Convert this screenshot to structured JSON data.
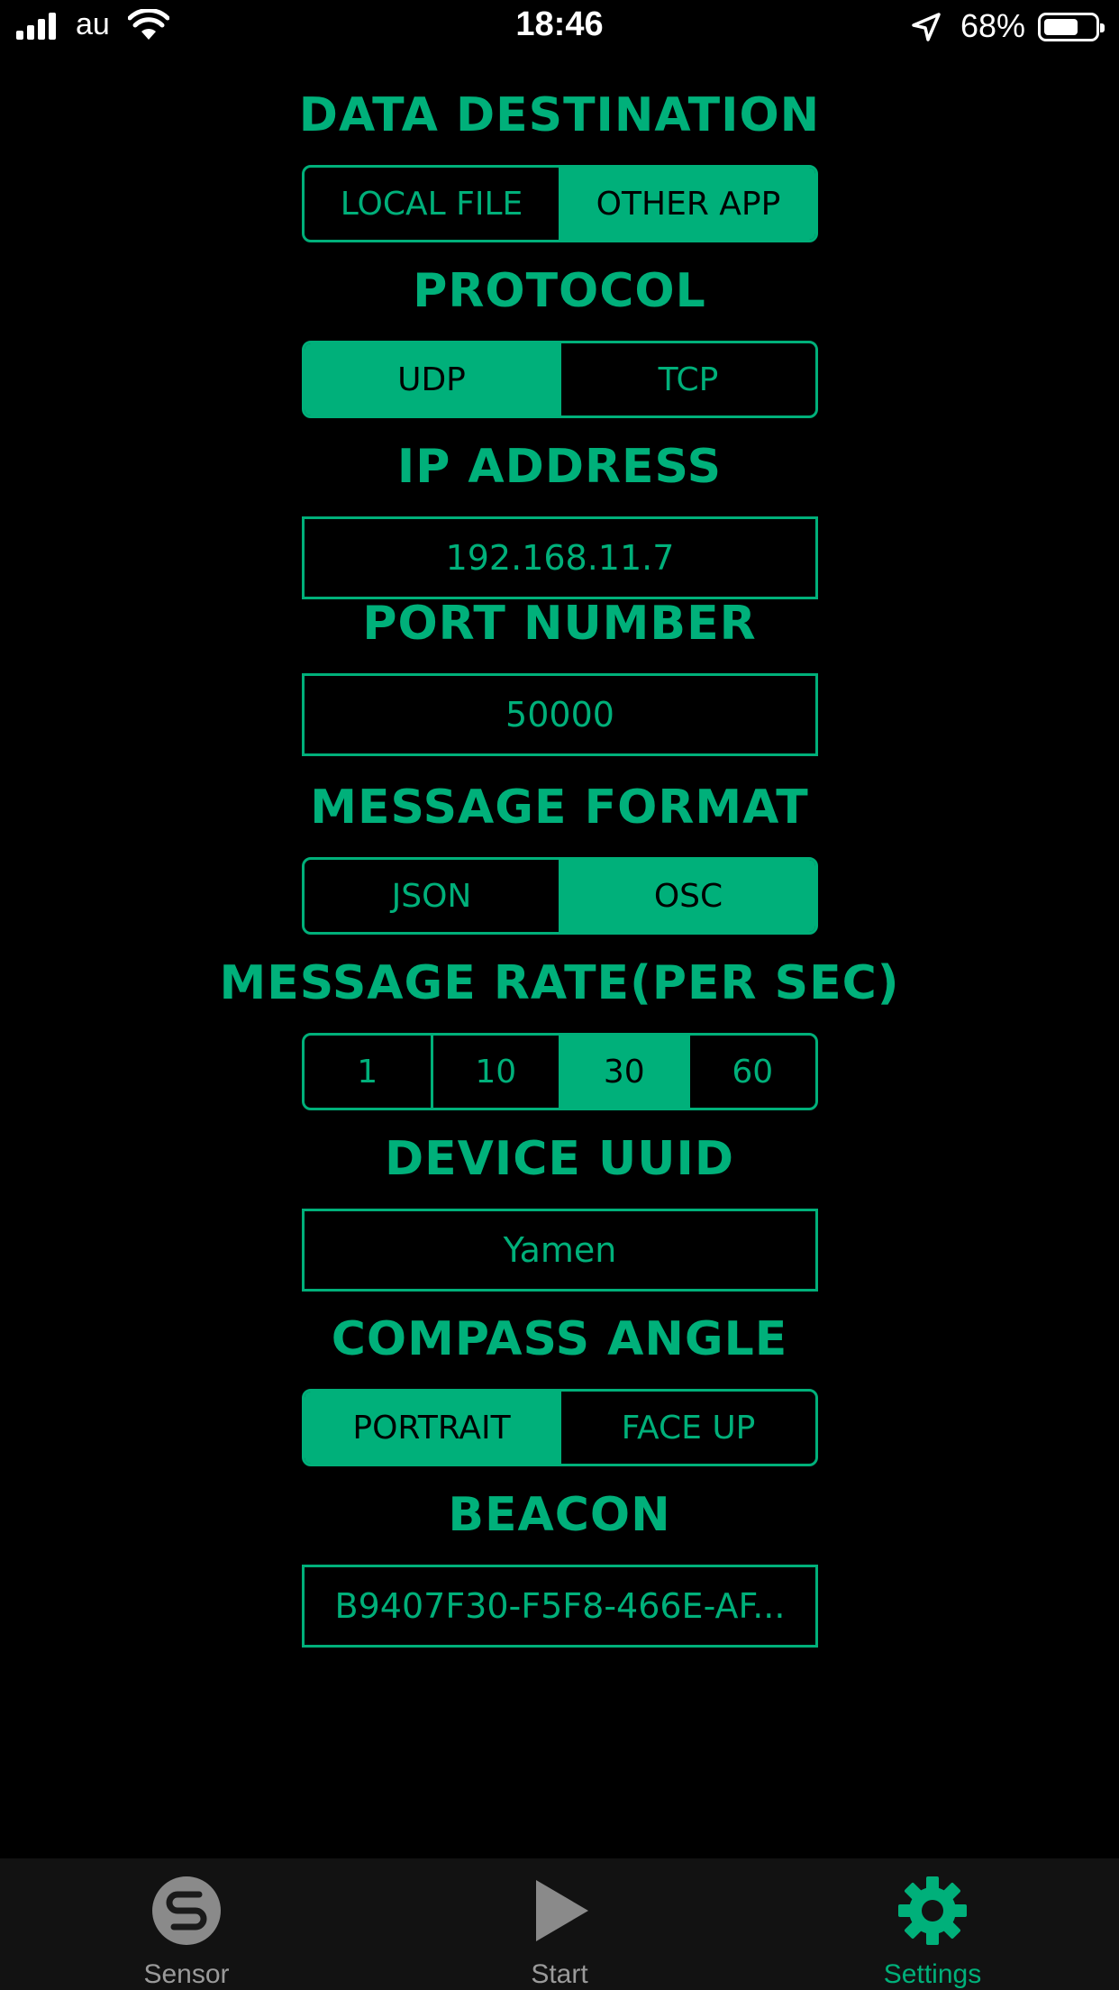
{
  "status_bar": {
    "carrier": "au",
    "time": "18:46",
    "battery_pct": "68%",
    "battery_level": 0.68
  },
  "sections": {
    "data_destination": {
      "title": "DATA DESTINATION",
      "options": [
        "LOCAL FILE",
        "OTHER APP"
      ],
      "selected": "OTHER APP"
    },
    "protocol": {
      "title": "PROTOCOL",
      "options": [
        "UDP",
        "TCP"
      ],
      "selected": "UDP"
    },
    "ip_address": {
      "title": "IP ADDRESS",
      "value": "192.168.11.7"
    },
    "port_number": {
      "title": "PORT NUMBER",
      "value": "50000"
    },
    "message_format": {
      "title": "MESSAGE FORMAT",
      "options": [
        "JSON",
        "OSC"
      ],
      "selected": "OSC"
    },
    "message_rate": {
      "title": "MESSAGE RATE(PER SEC)",
      "options": [
        "1",
        "10",
        "30",
        "60"
      ],
      "selected": "30"
    },
    "device_uuid": {
      "title": "DEVICE UUID",
      "value": "Yamen"
    },
    "compass_angle": {
      "title": "COMPASS ANGLE",
      "options": [
        "PORTRAIT",
        "FACE UP"
      ],
      "selected": "PORTRAIT"
    },
    "beacon": {
      "title": "BEACON",
      "value": "B9407F30-F5F8-466E-AF..."
    }
  },
  "tabs": [
    {
      "label": "Sensor",
      "icon": "sensor-icon",
      "active": false
    },
    {
      "label": "Start",
      "icon": "play-icon",
      "active": false
    },
    {
      "label": "Settings",
      "icon": "gear-icon",
      "active": true
    }
  ],
  "colors": {
    "accent": "#00b07a",
    "background": "#000000",
    "tab_bar": "#121212",
    "inactive_tab": "#9a9a9a"
  }
}
